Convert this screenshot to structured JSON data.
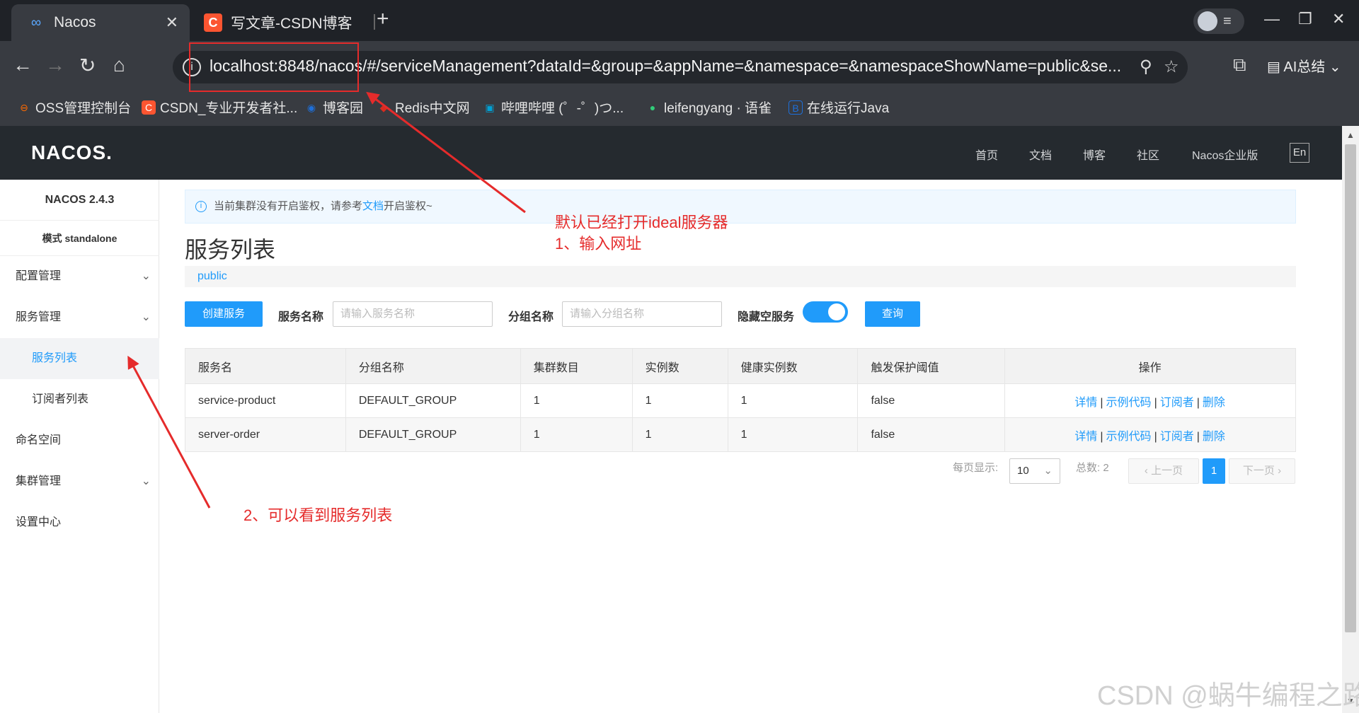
{
  "browser": {
    "tabs": [
      {
        "title": "Nacos",
        "icon": "infinity-icon"
      },
      {
        "title": "写文章-CSDN博客",
        "icon": "csdn-icon"
      }
    ],
    "address_url": "localhost:8848/nacos/#/serviceManagement?dataId=&group=&appName=&namespace=&namespaceShowName=public&se...",
    "ai_label": "AI总结",
    "bookmarks": [
      {
        "label": "OSS管理控制台",
        "color": "#ff6a00"
      },
      {
        "label": "CSDN_专业开发者社...",
        "color": "#fc5531"
      },
      {
        "label": "博客园",
        "color": "#1e6fd9"
      },
      {
        "label": "Redis中文网",
        "color": "#d82c20"
      },
      {
        "label": "哔哩哔哩 (゜-゜)つ...",
        "color": "#00a1d6"
      },
      {
        "label": "leifengyang · 语雀",
        "color": "#31cc79"
      },
      {
        "label": "在线运行Java",
        "color": "#1e6fd9"
      }
    ]
  },
  "header": {
    "logo": "NACOS.",
    "nav": [
      "首页",
      "文档",
      "博客",
      "社区",
      "Nacos企业版"
    ],
    "lang": "En"
  },
  "sidebar": {
    "version": "NACOS 2.4.3",
    "mode": "模式 standalone",
    "items": [
      {
        "label": "配置管理",
        "chevron": true
      },
      {
        "label": "服务管理",
        "chevron": true
      },
      {
        "label": "服务列表",
        "sub": true,
        "selected": true
      },
      {
        "label": "订阅者列表",
        "sub": true
      },
      {
        "label": "命名空间"
      },
      {
        "label": "集群管理",
        "chevron": true
      },
      {
        "label": "设置中心"
      }
    ]
  },
  "main": {
    "notice_prefix": "当前集群没有开启鉴权，请参考",
    "notice_link": "文档",
    "notice_suffix": "开启鉴权~",
    "title": "服务列表",
    "namespace": "public",
    "create_button": "创建服务",
    "service_name_label": "服务名称",
    "service_name_placeholder": "请输入服务名称",
    "group_name_label": "分组名称",
    "group_name_placeholder": "请输入分组名称",
    "hide_empty_label": "隐藏空服务",
    "hide_empty_on": true,
    "query_button": "查询",
    "table": {
      "headers": [
        "服务名",
        "分组名称",
        "集群数目",
        "实例数",
        "健康实例数",
        "触发保护阈值",
        "操作"
      ],
      "rows": [
        [
          "service-product",
          "DEFAULT_GROUP",
          "1",
          "1",
          "1",
          "false"
        ],
        [
          "server-order",
          "DEFAULT_GROUP",
          "1",
          "1",
          "1",
          "false"
        ]
      ],
      "ops": [
        "详情",
        "示例代码",
        "订阅者",
        "删除"
      ]
    },
    "pager": {
      "per_page_label": "每页显示:",
      "per_page": "10",
      "total_label": "总数:",
      "total": "2",
      "prev": "上一页",
      "current": "1",
      "next": "下一页"
    }
  },
  "annotations": {
    "note1_line1": "默认已经打开ideal服务器",
    "note1_line2": "1、输入网址",
    "note2": "2、可以看到服务列表",
    "color": "#e52b2b"
  },
  "watermark": "CSDN @蜗牛编程之路"
}
